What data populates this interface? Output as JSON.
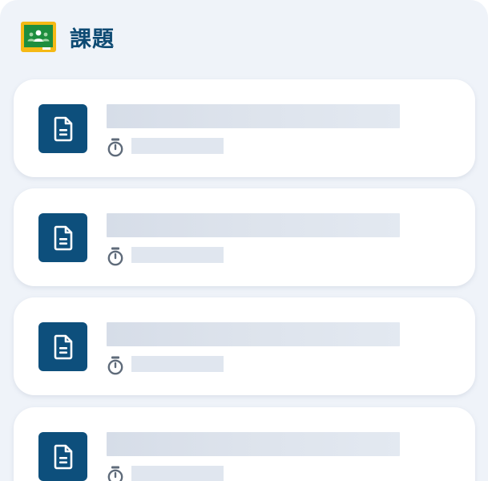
{
  "header": {
    "title": "課題",
    "logo_icon": "google-classroom-icon"
  },
  "colors": {
    "panel_background": "#eff3f9",
    "title_color": "#0d4a73",
    "doc_tile_color": "#0d4f7c",
    "skeleton_color": "#dde3ec"
  },
  "assignments": [
    {
      "icon": "document-icon",
      "meta_icon": "timer-icon",
      "state": "loading"
    },
    {
      "icon": "document-icon",
      "meta_icon": "timer-icon",
      "state": "loading"
    },
    {
      "icon": "document-icon",
      "meta_icon": "timer-icon",
      "state": "loading"
    },
    {
      "icon": "document-icon",
      "meta_icon": "timer-icon",
      "state": "loading"
    }
  ]
}
